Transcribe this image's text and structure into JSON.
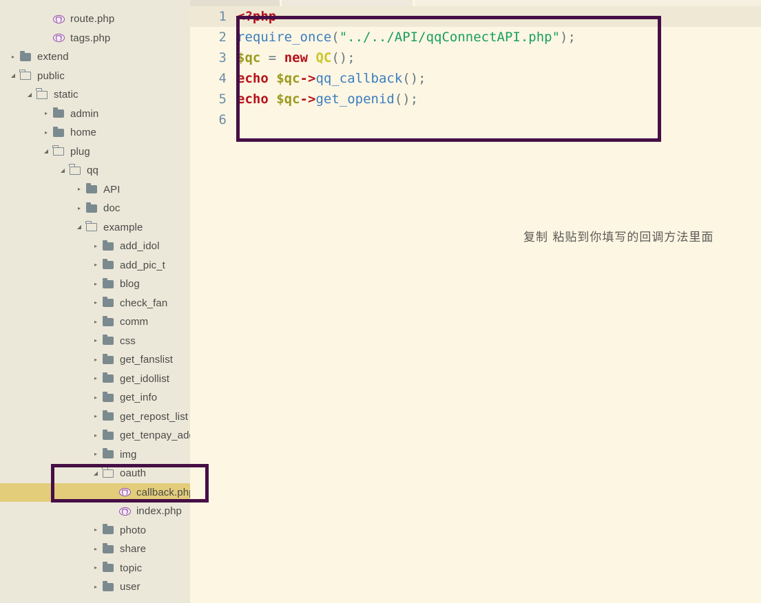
{
  "sidebar": {
    "tree": [
      {
        "label": "route.php",
        "depth": 2,
        "type": "php",
        "arrow": "none",
        "selected": false
      },
      {
        "label": "tags.php",
        "depth": 2,
        "type": "php",
        "arrow": "none",
        "selected": false
      },
      {
        "label": "extend",
        "depth": 0,
        "type": "folder-closed",
        "arrow": "collapsed",
        "selected": false
      },
      {
        "label": "public",
        "depth": 0,
        "type": "folder-open",
        "arrow": "expanded",
        "selected": false
      },
      {
        "label": "static",
        "depth": 1,
        "type": "folder-open",
        "arrow": "expanded",
        "selected": false
      },
      {
        "label": "admin",
        "depth": 2,
        "type": "folder-closed",
        "arrow": "collapsed",
        "selected": false
      },
      {
        "label": "home",
        "depth": 2,
        "type": "folder-closed",
        "arrow": "collapsed",
        "selected": false
      },
      {
        "label": "plug",
        "depth": 2,
        "type": "folder-open",
        "arrow": "expanded",
        "selected": false
      },
      {
        "label": "qq",
        "depth": 3,
        "type": "folder-open",
        "arrow": "expanded",
        "selected": false
      },
      {
        "label": "API",
        "depth": 4,
        "type": "folder-closed",
        "arrow": "collapsed",
        "selected": false
      },
      {
        "label": "doc",
        "depth": 4,
        "type": "folder-closed",
        "arrow": "collapsed",
        "selected": false
      },
      {
        "label": "example",
        "depth": 4,
        "type": "folder-open",
        "arrow": "expanded",
        "selected": false
      },
      {
        "label": "add_idol",
        "depth": 5,
        "type": "folder-closed",
        "arrow": "collapsed",
        "selected": false
      },
      {
        "label": "add_pic_t",
        "depth": 5,
        "type": "folder-closed",
        "arrow": "collapsed",
        "selected": false
      },
      {
        "label": "blog",
        "depth": 5,
        "type": "folder-closed",
        "arrow": "collapsed",
        "selected": false
      },
      {
        "label": "check_fan",
        "depth": 5,
        "type": "folder-closed",
        "arrow": "collapsed",
        "selected": false
      },
      {
        "label": "comm",
        "depth": 5,
        "type": "folder-closed",
        "arrow": "collapsed",
        "selected": false
      },
      {
        "label": "css",
        "depth": 5,
        "type": "folder-closed",
        "arrow": "collapsed",
        "selected": false
      },
      {
        "label": "get_fanslist",
        "depth": 5,
        "type": "folder-closed",
        "arrow": "collapsed",
        "selected": false
      },
      {
        "label": "get_idollist",
        "depth": 5,
        "type": "folder-closed",
        "arrow": "collapsed",
        "selected": false
      },
      {
        "label": "get_info",
        "depth": 5,
        "type": "folder-closed",
        "arrow": "collapsed",
        "selected": false
      },
      {
        "label": "get_repost_list",
        "depth": 5,
        "type": "folder-closed",
        "arrow": "collapsed",
        "selected": false
      },
      {
        "label": "get_tenpay_addr",
        "depth": 5,
        "type": "folder-closed",
        "arrow": "collapsed",
        "selected": false
      },
      {
        "label": "img",
        "depth": 5,
        "type": "folder-closed",
        "arrow": "collapsed",
        "selected": false
      },
      {
        "label": "oauth",
        "depth": 5,
        "type": "folder-open",
        "arrow": "expanded",
        "selected": false
      },
      {
        "label": "callback.php",
        "depth": 6,
        "type": "php",
        "arrow": "none",
        "selected": true
      },
      {
        "label": "index.php",
        "depth": 6,
        "type": "php",
        "arrow": "none",
        "selected": false
      },
      {
        "label": "photo",
        "depth": 5,
        "type": "folder-closed",
        "arrow": "collapsed",
        "selected": false
      },
      {
        "label": "share",
        "depth": 5,
        "type": "folder-closed",
        "arrow": "collapsed",
        "selected": false
      },
      {
        "label": "topic",
        "depth": 5,
        "type": "folder-closed",
        "arrow": "collapsed",
        "selected": false
      },
      {
        "label": "user",
        "depth": 5,
        "type": "folder-closed",
        "arrow": "collapsed",
        "selected": false
      }
    ],
    "selected_file": "callback.php"
  },
  "editor": {
    "gutter": [
      "1",
      "2",
      "3",
      "4",
      "5",
      "6"
    ],
    "lines": [
      {
        "n": "1",
        "current": true,
        "tokens": [
          {
            "t": "<?php",
            "c": "t-tag"
          }
        ]
      },
      {
        "n": "2",
        "current": false,
        "tokens": [
          {
            "t": "require_once",
            "c": "t-fn"
          },
          {
            "t": "(",
            "c": "t-punc"
          },
          {
            "t": "\"../../API/qqConnectAPI.php\"",
            "c": "t-strg"
          },
          {
            "t": ")",
            "c": "t-punc"
          },
          {
            "t": ";",
            "c": "t-punc"
          }
        ]
      },
      {
        "n": "3",
        "current": false,
        "tokens": [
          {
            "t": "$qc",
            "c": "t-var"
          },
          {
            "t": " ",
            "c": "t-punc"
          },
          {
            "t": "=",
            "c": "t-punc"
          },
          {
            "t": " ",
            "c": "t-punc"
          },
          {
            "t": "new",
            "c": "t-kw"
          },
          {
            "t": " ",
            "c": "t-punc"
          },
          {
            "t": "QC",
            "c": "t-cls"
          },
          {
            "t": "();",
            "c": "t-punc"
          }
        ]
      },
      {
        "n": "4",
        "current": false,
        "tokens": [
          {
            "t": "echo",
            "c": "t-kw"
          },
          {
            "t": " ",
            "c": "t-punc"
          },
          {
            "t": "$qc",
            "c": "t-var"
          },
          {
            "t": "->",
            "c": "t-arrow"
          },
          {
            "t": "qq_callback",
            "c": "t-fn"
          },
          {
            "t": "();",
            "c": "t-punc"
          }
        ]
      },
      {
        "n": "5",
        "current": false,
        "tokens": [
          {
            "t": "echo",
            "c": "t-kw"
          },
          {
            "t": " ",
            "c": "t-punc"
          },
          {
            "t": "$qc",
            "c": "t-var"
          },
          {
            "t": "->",
            "c": "t-arrow"
          },
          {
            "t": "get_openid",
            "c": "t-fn"
          },
          {
            "t": "();",
            "c": "t-punc"
          }
        ]
      },
      {
        "n": "6",
        "current": false,
        "tokens": []
      }
    ]
  },
  "annotation": {
    "caption": "复制 粘贴到你填写的回调方法里面",
    "box_color": "#460f46",
    "highlight_color": "#e3cd7b"
  }
}
